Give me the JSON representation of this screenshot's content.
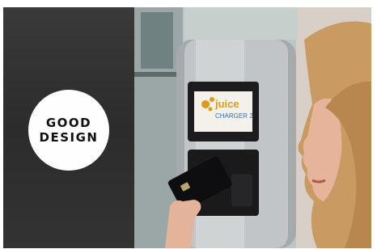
{
  "badge": {
    "line1": "GOOD",
    "line2": "DESIGN"
  },
  "charger": {
    "brand": "juice",
    "model": "CHARGER 2"
  },
  "colors": {
    "panel": "#2f2f2f",
    "badge": "#ffffff",
    "logo_accent": "#e09a1a"
  }
}
